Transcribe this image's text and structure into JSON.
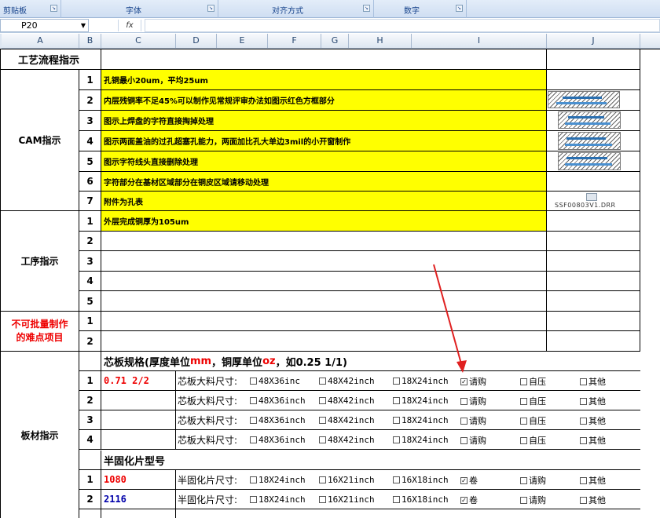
{
  "ribbon": {
    "groups": [
      {
        "label": "剪贴板"
      },
      {
        "label": "字体"
      },
      {
        "label": "对齐方式"
      },
      {
        "label": "数字"
      }
    ]
  },
  "formula_bar": {
    "name_box": "P20",
    "fx_label": "fx",
    "value": ""
  },
  "columns": [
    "A",
    "B",
    "C",
    "D",
    "E",
    "F",
    "G",
    "H",
    "I",
    "J"
  ],
  "sheet": {
    "title": "工艺流程指示",
    "cam": {
      "label": "CAM指示",
      "rows": [
        {
          "n": "1",
          "text": "孔铜最小20um，平均25um"
        },
        {
          "n": "2",
          "text": "内层残铜率不足45%可以制作见常规评审办法如图示红色方框部分"
        },
        {
          "n": "3",
          "text": "图示上焊盘的字符直接掏掉处理"
        },
        {
          "n": "4",
          "text": "图示两面盖油的过孔超塞孔能力，两面加比孔大单边3mil的小开窗制作"
        },
        {
          "n": "5",
          "text": "图示字符线头直接删除处理"
        },
        {
          "n": "6",
          "text": "字符部分在基材区域部分在铜皮区域请移动处理"
        },
        {
          "n": "7",
          "text": "附件为孔表"
        }
      ],
      "attachment": "SSF00803V1.DRR"
    },
    "process": {
      "label": "工序指示",
      "rows": [
        {
          "n": "1",
          "text": "外层完成铜厚为105um"
        },
        {
          "n": "2",
          "text": ""
        },
        {
          "n": "3",
          "text": ""
        },
        {
          "n": "4",
          "text": ""
        },
        {
          "n": "5",
          "text": ""
        }
      ]
    },
    "difficult": {
      "label_line1": "不可批量制作",
      "label_line2": "的难点项目",
      "rows": [
        {
          "n": "1"
        },
        {
          "n": "2"
        }
      ]
    },
    "material": {
      "label": "板材指示",
      "core_header": {
        "pre": "芯板规格(厚度单位",
        "u1": "mm",
        "mid": "，铜厚单位",
        "u2": "oz",
        "post": "，如0.25 1/1)"
      },
      "core_rows": [
        {
          "n": "1",
          "spec": "0.71 2/2",
          "label": "芯板大料尺寸:",
          "o1": "48X36inc",
          "o2": "48X42inch",
          "o3": "18X24inch",
          "o4": "请购",
          "o4_checked": "✓",
          "o5": "自压",
          "o6": "其他"
        },
        {
          "n": "2",
          "spec": "",
          "label": "芯板大料尺寸:",
          "o1": "48X36inch",
          "o2": "48X42inch",
          "o3": "18X24inch",
          "o4": "请购",
          "o4_checked": "",
          "o5": "自压",
          "o6": "其他"
        },
        {
          "n": "3",
          "spec": "",
          "label": "芯板大料尺寸:",
          "o1": "48X36inch",
          "o2": "48X42inch",
          "o3": "18X24inch",
          "o4": "请购",
          "o4_checked": "",
          "o5": "自压",
          "o6": "其他"
        },
        {
          "n": "4",
          "spec": "",
          "label": "芯板大料尺寸:",
          "o1": "48X36inch",
          "o2": "48X42inch",
          "o3": "18X24inch",
          "o4": "请购",
          "o4_checked": "",
          "o5": "自压",
          "o6": "其他"
        }
      ],
      "prepreg_header": "半固化片型号",
      "prepreg_rows": [
        {
          "n": "1",
          "type": "1080",
          "label": "半固化片尺寸:",
          "o1": "18X24inch",
          "o2": "16X21inch",
          "o3": "16X18inch",
          "o4": "卷",
          "o4_checked": "✓",
          "o5": "请购",
          "o6": "其他"
        },
        {
          "n": "2",
          "type": "2116",
          "label": "半固化片尺寸:",
          "o1": "18X24inch",
          "o2": "16X21inch",
          "o3": "16X18inch",
          "o4": "卷",
          "o4_checked": "✓",
          "o5": "请购",
          "o6": "其他"
        }
      ]
    }
  },
  "colors": {
    "highlight": "#ffff00",
    "annotation_arrow": "#e02020",
    "red_text": "#e00000",
    "blue_text": "#0000aa"
  }
}
